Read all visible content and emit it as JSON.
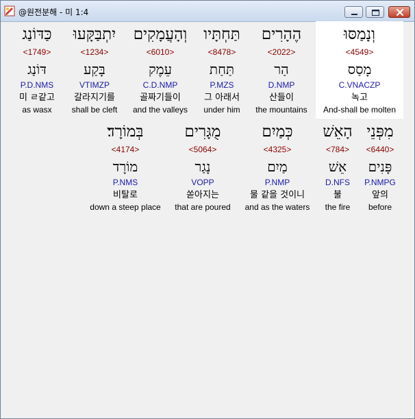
{
  "window": {
    "title": "@원전분해 - 미 1:4",
    "accent_color": "#c2402a"
  },
  "controls": {
    "minimize": "minimize-icon",
    "maximize": "maximize-icon",
    "close": "close-icon"
  },
  "rows": [
    {
      "words": [
        {
          "hebrew": "וְנָמַסּוּ",
          "strong": "<4549>",
          "lemma": "מָסַס",
          "parse": "C.VNACZP",
          "korean": "녹고",
          "english": "And-shall be molten",
          "highlighted": true
        },
        {
          "hebrew": "הֶהָרִים",
          "strong": "<2022>",
          "lemma": "הַר",
          "parse": "D.NMP",
          "korean": "산들이",
          "english": "the mountains"
        },
        {
          "hebrew": "תַּחְתָּיו",
          "strong": "<8478>",
          "lemma": "תַּחַת",
          "parse": "P.MZS",
          "korean": "그 아래서",
          "english": "under him"
        },
        {
          "hebrew": "וְהָעֲמָקִים",
          "strong": "<6010>",
          "lemma": "עֵמֶק",
          "parse": "C.D.NMP",
          "korean": "골짜기들이",
          "english": "and the valleys"
        },
        {
          "hebrew": "יִתְבַּקָּעוּ",
          "strong": "<1234>",
          "lemma": "בָּקַע",
          "parse": "VTIMZP",
          "korean": "갈라지기를",
          "english": "shall be cleft"
        },
        {
          "hebrew": "כַּדּוֹנַג",
          "strong": "<1749>",
          "lemma": "דּוֹנַג",
          "parse": "P.D.NMS",
          "korean": "미 ㄹ같고",
          "english": "as wasx"
        }
      ]
    },
    {
      "words": [
        {
          "hebrew": "מִפְּנֵי",
          "strong": "<6440>",
          "lemma": "פָּנִים",
          "parse": "P.NMPG",
          "korean": "앞의",
          "english": "before"
        },
        {
          "hebrew": "הָאֵשׁ",
          "strong": "<784>",
          "lemma": "אֵשׁ",
          "parse": "D.NFS",
          "korean": "불",
          "english": "the fire"
        },
        {
          "hebrew": "כְּמַיִם",
          "strong": "<4325>",
          "lemma": "מַיִם",
          "parse": "P.NMP",
          "korean": "물 같을 것이니",
          "english": "and as the waters"
        },
        {
          "hebrew": "מֻגָּרִים",
          "strong": "<5064>",
          "lemma": "נָגַר",
          "parse": "VOPP",
          "korean": "쏟아지는",
          "english": "that are poured"
        },
        {
          "hebrew": "בְּמוֹרָד׃",
          "strong": "<4174>",
          "lemma": "מוֹרָד",
          "parse": "P.NMS",
          "korean": "비탈로",
          "english": "down a steep place"
        }
      ]
    }
  ]
}
